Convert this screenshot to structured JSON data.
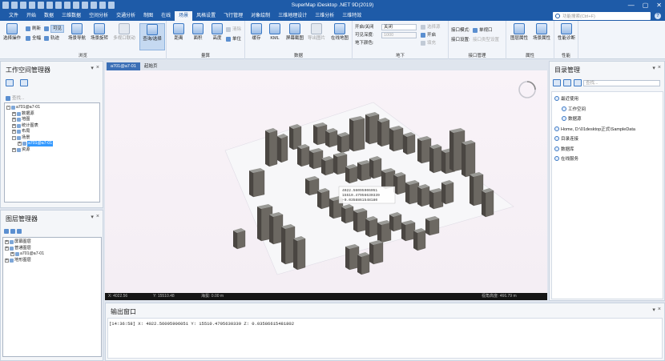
{
  "app": {
    "title": "SuperMap iDesktop .NET 9D(2019)",
    "window_controls": [
      "—",
      "▢",
      "✕"
    ]
  },
  "menu": {
    "tabs": [
      "文件",
      "开始",
      "数据",
      "三维数据",
      "空间分析",
      "交通分析",
      "制图",
      "在线",
      "场景",
      "风格设置",
      "飞行管理",
      "对象绘制",
      "三维地理设计",
      "三维分析",
      "三维特效"
    ],
    "active": "场景",
    "search_placeholder": "功能搜索(Ctrl+F)"
  },
  "ribbon": {
    "groups": {
      "browse": "浏览",
      "measure": "量算",
      "data": "数据",
      "underground": "地下",
      "interface": "接口管理",
      "property": "属性",
      "performance": "性能"
    },
    "buttons": {
      "select_operation": "选择操作",
      "refresh": "刷新",
      "fullview": "全幅",
      "roam": "漫游",
      "fly": "轨迹",
      "visible": "可见",
      "scene_info": "场景导航",
      "scene_zoom": "场景旋转",
      "multi_view": "多视口联动",
      "query_attr": "查询/选择",
      "distance": "距离",
      "area": "面积",
      "height": "高度",
      "clear": "清除",
      "unit": "单位",
      "cache": "缓存",
      "kml": "KML",
      "screen_capture": "屏幕截图",
      "layered": "导出图片",
      "online_map": "在线地图",
      "toggle_on_label": "开启/关闭",
      "toggle_value": "关闭",
      "visible_depth_label": "可见深度:",
      "visible_depth_value": "1000",
      "underground_color_label": "地下颜色:",
      "interface_mode_label": "接口模式:",
      "interface_mode_value": "单视口",
      "interface_setting_label": "接口设置:",
      "interface_setting_value": "接口类型设置",
      "scene_property": "图层属性",
      "scene_prop2": "场景属性",
      "performance_diag": "性能诊断",
      "select_source": "选择源",
      "open": "开启",
      "fill": "填充"
    }
  },
  "workspace_panel": {
    "title": "工作空间管理器",
    "search_placeholder": "查找...",
    "tree": [
      {
        "label": "a701@a7-01",
        "level": 0,
        "expanded": true
      },
      {
        "label": "数据源",
        "level": 1
      },
      {
        "label": "地图",
        "level": 1
      },
      {
        "label": "统计图表",
        "level": 1
      },
      {
        "label": "布局",
        "level": 1
      },
      {
        "label": "场景",
        "level": 1,
        "expanded": true
      },
      {
        "label": "a701@a7-01",
        "level": 2,
        "selected": true
      },
      {
        "label": "资源",
        "level": 1
      }
    ]
  },
  "layer_panel": {
    "title": "图层管理器",
    "tree": [
      {
        "label": "屏幕图层",
        "level": 0
      },
      {
        "label": "普通图层",
        "level": 0
      },
      {
        "label": "a701@a7-01",
        "level": 1
      },
      {
        "label": "地形图层",
        "level": 0
      }
    ]
  },
  "document": {
    "tabs": [
      "a701@a7-01",
      "起始页"
    ],
    "active": "a701@a7-01",
    "coord_tooltip": [
      "4022.56095906051",
      "15510.47956630339",
      "-0.0358861548180"
    ]
  },
  "status": {
    "x": "X: 4022.56",
    "y": "Y: 15510.48",
    "alt": "海拔: 0.00 m",
    "extra": "视角高度: 466.79 m"
  },
  "catalog_panel": {
    "title": "目录管理",
    "search_placeholder": "查找...",
    "items": [
      {
        "label": "最近使用",
        "level": 0
      },
      {
        "label": "工作空间",
        "level": 1
      },
      {
        "label": "数据源",
        "level": 1
      },
      {
        "label": "Home, D:\\01desktop正式\\SampleData",
        "level": 0
      },
      {
        "label": "目录连接",
        "level": 0
      },
      {
        "label": "数据库",
        "level": 0
      },
      {
        "label": "在线服务",
        "level": 0
      }
    ]
  },
  "output_panel": {
    "title": "输出窗口",
    "log": "[14:36:58] X:    4022.56095906051 Y:   15510.4795630339 Z:   0.03586615481802"
  },
  "colors": {
    "brand": "#1e5ba8",
    "selection": "#3399ff",
    "scene_bg": "#f6f0f6"
  }
}
